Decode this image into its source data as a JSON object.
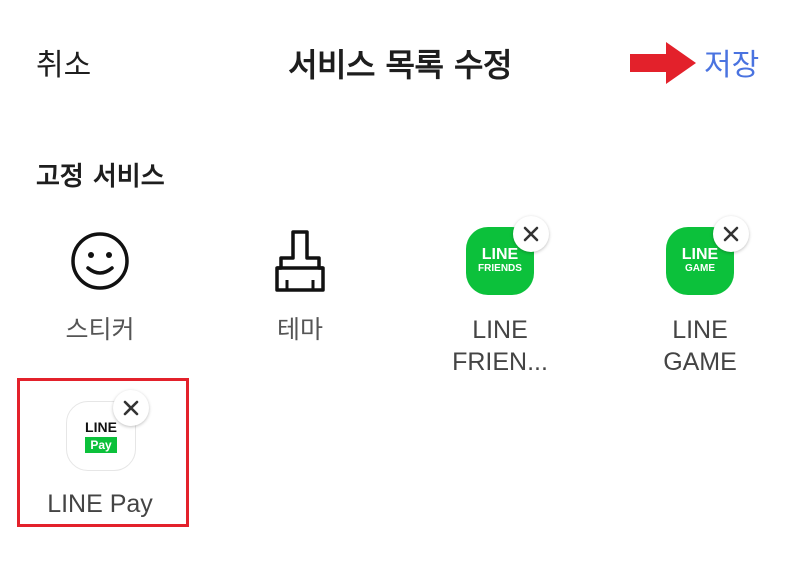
{
  "header": {
    "cancel_label": "취소",
    "title": "서비스 목록 수정",
    "save_label": "저장"
  },
  "section": {
    "title": "고정 서비스"
  },
  "services": [
    {
      "label": "스티커",
      "icon": "smiley-icon"
    },
    {
      "label": "테마",
      "icon": "brush-icon"
    },
    {
      "label": "LINE\nFRIEN...",
      "icon": "line-friends-logo",
      "logo_line1": "LINE",
      "logo_line2": "FRIENDS"
    },
    {
      "label": "LINE\nGAME",
      "icon": "line-game-logo",
      "logo_line1": "LINE",
      "logo_line2": "GAME"
    },
    {
      "label": "LINE Pay",
      "icon": "line-pay-logo",
      "logo_line1": "LINE",
      "logo_line2": "Pay"
    }
  ],
  "colors": {
    "accent": "#4a73e0",
    "brand_green": "#0cc13b",
    "annotation_red": "#e3212b"
  }
}
